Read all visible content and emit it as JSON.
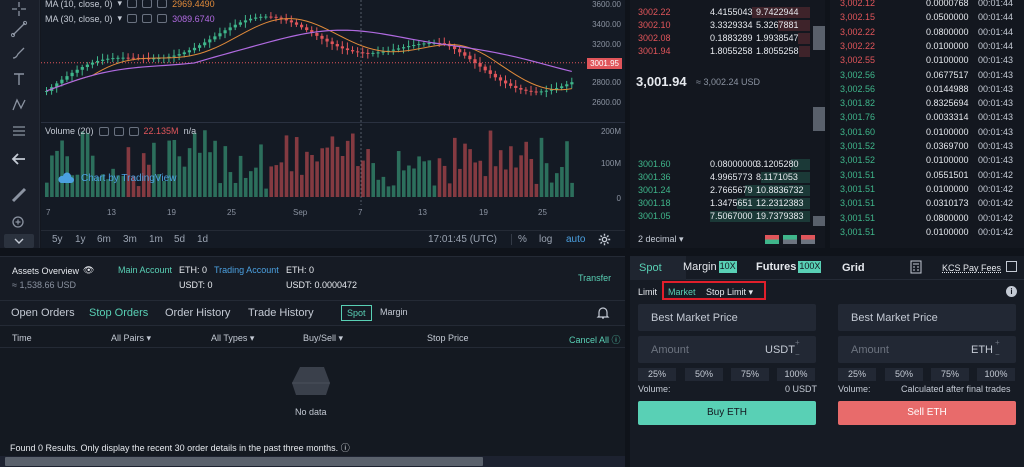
{
  "chart": {
    "ma_lines": [
      {
        "label": "MA (10, close, 0)",
        "value": "2969.4490",
        "color": "#e08a3a"
      },
      {
        "label": "MA (30, close, 0)",
        "value": "3089.6740",
        "color": "#b06ae0"
      }
    ],
    "price_ticks": [
      "3600.00",
      "3400.00",
      "3200.00",
      "3000.00",
      "2800.00",
      "2600.00"
    ],
    "last_price_tag": "3001.95",
    "volume_label": "Volume (20)",
    "volume_value": "22.135M",
    "volume_na": "n/a",
    "volume_ticks": [
      "200M",
      "100M",
      "0"
    ],
    "watermark": "Chart by TradingView",
    "time_labels": [
      "7",
      "13",
      "19",
      "25",
      "Sep",
      "7",
      "13",
      "19",
      "25"
    ],
    "ranges": [
      "5y",
      "1y",
      "6m",
      "3m",
      "1m",
      "5d",
      "1d"
    ],
    "clock": "17:01:45 (UTC)",
    "scale_pct": "%",
    "scale_log": "log",
    "scale_auto": "auto"
  },
  "orderbook": {
    "asks": [
      {
        "price": "3002.22",
        "amount": "4.4155043",
        "total": "9.7422944"
      },
      {
        "price": "3002.10",
        "amount": "3.3329334",
        "total": "5.3267881"
      },
      {
        "price": "3002.08",
        "amount": "0.1883289",
        "total": "1.9938547"
      },
      {
        "price": "3001.94",
        "amount": "1.8055258",
        "total": "1.8055258"
      }
    ],
    "mid_price": "3,001.94",
    "mid_usd": "≈ 3,002.24 USD",
    "bids": [
      {
        "price": "3001.60",
        "amount": "0.08000000",
        "total": "3.1205280"
      },
      {
        "price": "3001.36",
        "amount": "4.9965773",
        "total": "8.1171053"
      },
      {
        "price": "3001.24",
        "amount": "2.7665679",
        "total": "10.8836732"
      },
      {
        "price": "3001.18",
        "amount": "1.3475651",
        "total": "12.2312383"
      },
      {
        "price": "3001.05",
        "amount": "7.5067000",
        "total": "19.7379383"
      }
    ],
    "decimal": "2 decimal"
  },
  "trades": [
    {
      "price": "3,002.12",
      "amount": "0.0000768",
      "time": "00:01:44",
      "side": "sell"
    },
    {
      "price": "3,002.15",
      "amount": "0.0500000",
      "time": "00:01:44",
      "side": "sell"
    },
    {
      "price": "3,002.22",
      "amount": "0.0800000",
      "time": "00:01:44",
      "side": "sell"
    },
    {
      "price": "3,002.22",
      "amount": "0.0100000",
      "time": "00:01:44",
      "side": "sell"
    },
    {
      "price": "3,002.55",
      "amount": "0.0100000",
      "time": "00:01:43",
      "side": "sell"
    },
    {
      "price": "3,002.56",
      "amount": "0.0677517",
      "time": "00:01:43",
      "side": "buy"
    },
    {
      "price": "3,002.56",
      "amount": "0.0144988",
      "time": "00:01:43",
      "side": "buy"
    },
    {
      "price": "3,001.82",
      "amount": "0.8325694",
      "time": "00:01:43",
      "side": "buy"
    },
    {
      "price": "3,001.76",
      "amount": "0.0033314",
      "time": "00:01:43",
      "side": "buy"
    },
    {
      "price": "3,001.60",
      "amount": "0.0100000",
      "time": "00:01:43",
      "side": "buy"
    },
    {
      "price": "3,001.52",
      "amount": "0.0369700",
      "time": "00:01:43",
      "side": "buy"
    },
    {
      "price": "3,001.52",
      "amount": "0.0100000",
      "time": "00:01:43",
      "side": "buy"
    },
    {
      "price": "3,001.51",
      "amount": "0.0551501",
      "time": "00:01:42",
      "side": "buy"
    },
    {
      "price": "3,001.51",
      "amount": "0.0100000",
      "time": "00:01:42",
      "side": "buy"
    },
    {
      "price": "3,001.51",
      "amount": "0.0310173",
      "time": "00:01:42",
      "side": "buy"
    },
    {
      "price": "3,001.51",
      "amount": "0.0800000",
      "time": "00:01:42",
      "side": "buy"
    },
    {
      "price": "3,001.51",
      "amount": "0.0100000",
      "time": "00:01:42",
      "side": "buy"
    }
  ],
  "assets": {
    "title": "Assets Overview",
    "total": "≈ 1,538.66 USD",
    "main_account": "Main Account",
    "main_eth": "ETH: 0",
    "main_usdt": "USDT: 0",
    "trading_account": "Trading Account",
    "trading_eth": "ETH: 0",
    "trading_usdt": "USDT: 0.0000472",
    "transfer": "Transfer"
  },
  "order_tabs": {
    "tabs": [
      "Open Orders",
      "Stop Orders",
      "Order History",
      "Trade History"
    ],
    "active": "Stop Orders",
    "spot": "Spot",
    "margin": "Margin"
  },
  "orders_table": {
    "time": "Time",
    "all_pairs": "All Pairs",
    "all_types": "All Types",
    "buy_sell": "Buy/Sell",
    "stop_price": "Stop Price",
    "cancel_all": "Cancel All",
    "no_data": "No data",
    "footer": "Found 0 Results. Only display the recent 30 order details in the past three months."
  },
  "trade": {
    "tabs": {
      "spot": "Spot",
      "margin": "Margin",
      "margin_badge": "10X",
      "futures": "Futures",
      "futures_badge": "100X",
      "grid": "Grid"
    },
    "kcs_fees": "KCS Pay Fees",
    "order_types": {
      "limit": "Limit",
      "market": "Market",
      "stop_limit": "Stop Limit"
    },
    "best_price": "Best Market Price",
    "amount": "Amount",
    "buy_unit": "USDT",
    "sell_unit": "ETH",
    "pcts": [
      "25%",
      "50%",
      "75%",
      "100%"
    ],
    "volume_label": "Volume:",
    "buy_volume": "0 USDT",
    "sell_volume": "Calculated after final trades",
    "buy_btn": "Buy ETH",
    "sell_btn": "Sell ETH"
  },
  "colors": {
    "buy": "#3fb68b",
    "sell": "#e0555a",
    "accent": "#59d0b5",
    "highlight": "#e01f2b"
  }
}
